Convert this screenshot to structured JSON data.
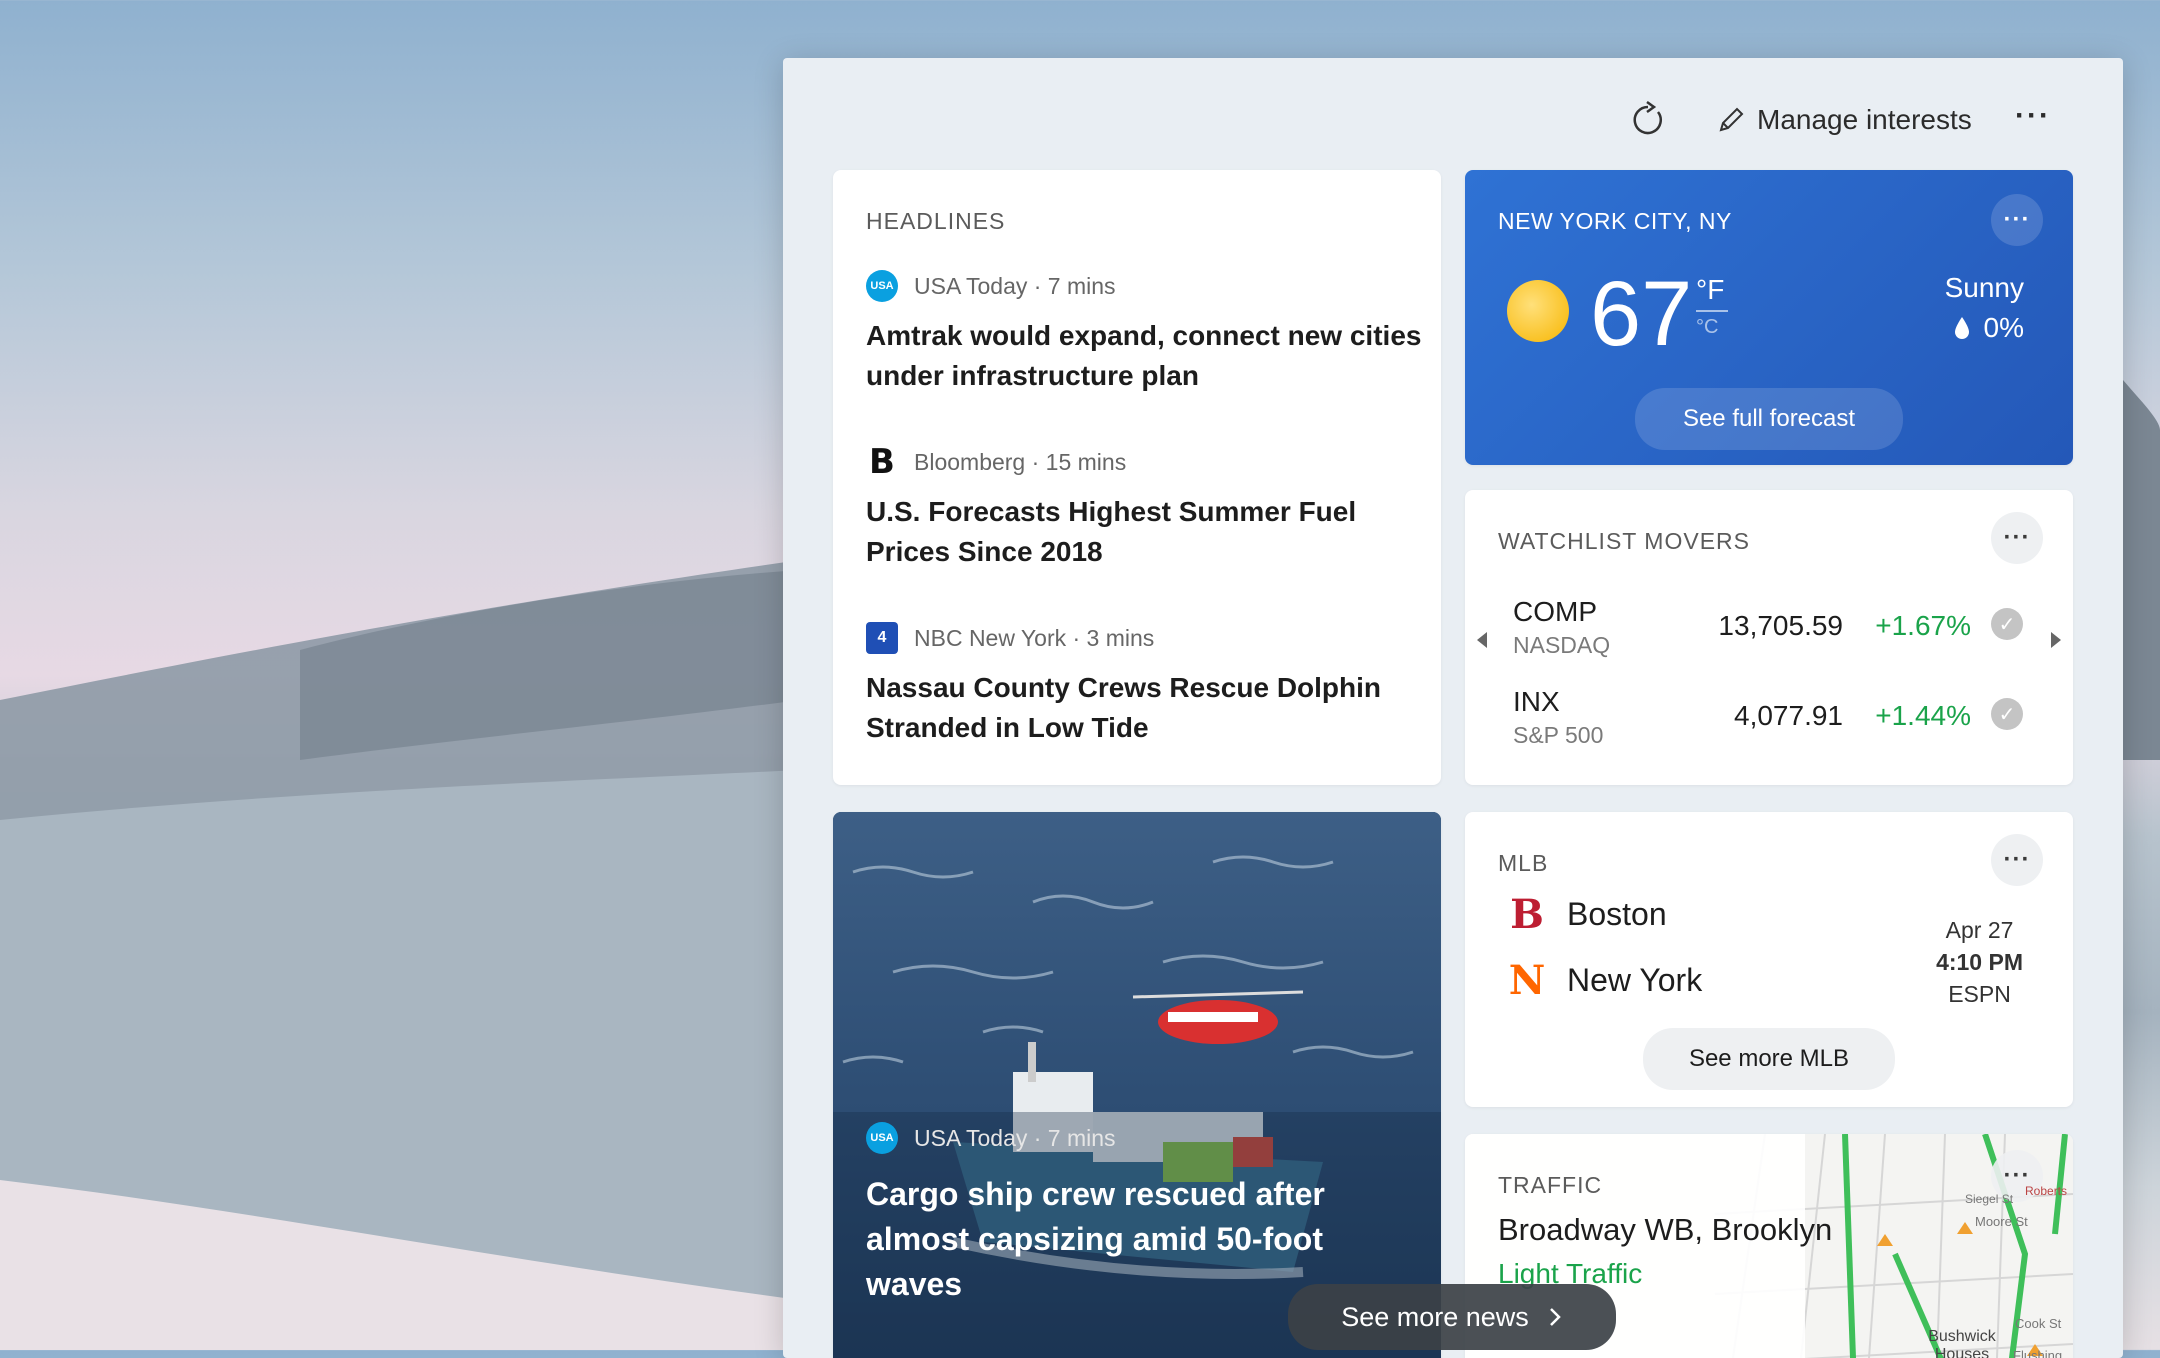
{
  "toolbar": {
    "refresh_icon": "refresh-icon",
    "manage_label": "Manage interests",
    "more_label": "···"
  },
  "headlines": {
    "title": "HEADLINES",
    "items": [
      {
        "source": "USA Today · 7 mins",
        "headline": "Amtrak would expand, connect new cities under infrastructure plan",
        "logo": "usa-today-logo"
      },
      {
        "source": "Bloomberg · 15 mins",
        "headline": "U.S. Forecasts Highest Summer Fuel Prices Since 2018",
        "logo": "bloomberg-logo"
      },
      {
        "source": "NBC New York · 3 mins",
        "headline": "Nassau County Crews Rescue Dolphin Stranded in Low Tide",
        "logo": "nbc-new-york-logo"
      }
    ]
  },
  "weather": {
    "location": "NEW YORK CITY, NY",
    "temp": "67",
    "unit_f": "°F",
    "unit_c": "°C",
    "condition": "Sunny",
    "precip": "0%",
    "forecast_label": "See full forecast"
  },
  "watchlist": {
    "title": "WATCHLIST MOVERS",
    "rows": [
      {
        "symbol": "COMP",
        "exchange": "NASDAQ",
        "value": "13,705.59",
        "change": "+1.67%"
      },
      {
        "symbol": "INX",
        "exchange": "S&P 500",
        "value": "4,077.91",
        "change": "+1.44%"
      }
    ]
  },
  "photo_story": {
    "source": "USA Today · 7 mins",
    "headline": "Cargo ship crew rescued after almost capsizing amid 50-foot waves"
  },
  "mlb": {
    "title": "MLB",
    "team1": "Boston",
    "team2": "New York",
    "date": "Apr 27",
    "time": "4:10 PM",
    "network": "ESPN",
    "more_label": "See more MLB"
  },
  "traffic": {
    "title": "TRAFFIC",
    "location": "Broadway WB, Brooklyn",
    "status": "Light Traffic",
    "map_labels": [
      "Bushwick Houses",
      "Moore St",
      "Cook St",
      "Flushing",
      "Siegel St",
      "Roberts"
    ]
  },
  "see_more_news": "See more news",
  "colors": {
    "weather_bg": "#2f72d4",
    "positive": "#1aa34a",
    "traffic_green": "#1aa34a"
  }
}
